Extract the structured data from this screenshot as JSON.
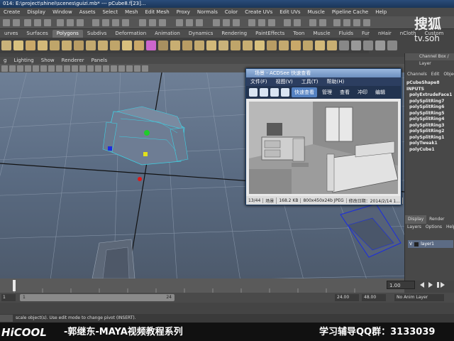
{
  "window": {
    "title": "014: E:\\project\\shinei\\scenes\\guizi.mb*  ---  pCube8.f[23]..."
  },
  "menubar": [
    "Create",
    "Display",
    "Window",
    "Assets",
    "Select",
    "Mesh",
    "Edit Mesh",
    "Proxy",
    "Normals",
    "Color",
    "Create UVs",
    "Edit UVs",
    "Muscle",
    "Pipeline Cache",
    "Help"
  ],
  "shelf_tabs": [
    "urves",
    "Surfaces",
    "Polygons",
    "Subdivs",
    "Deformation",
    "Animation",
    "Dynamics",
    "Rendering",
    "PaintEffects",
    "Toon",
    "Muscle",
    "Fluids",
    "Fur",
    "nHair",
    "nCloth",
    "Custom"
  ],
  "shelf_active": "Polygons",
  "panel_menu": [
    "g",
    "Lighting",
    "Show",
    "Renderer",
    "Panels"
  ],
  "acdsee": {
    "title": "场景 - ACDSee 快速查看",
    "menu": [
      "文件(F)",
      "视图(V)",
      "工具(T)",
      "帮助(H)"
    ],
    "tabs": [
      "快速查看",
      "管理",
      "查看",
      "冲印",
      "编辑"
    ],
    "active_tab": "快速查看",
    "status": [
      "13/44",
      "场景",
      "168.2 KB",
      "800x450x24b JPEG",
      "修改日期：2014/2/14 1..."
    ]
  },
  "right_panel": {
    "header": "Channel Box / Layer",
    "menu": [
      "Channels",
      "Edit",
      "Object"
    ],
    "items": [
      "pCubeShape8",
      "INPUTS",
      "polyExtrudeFace1",
      "polySplitRing7",
      "polySplitRing6",
      "polySplitRing5",
      "polySplitRing4",
      "polySplitRing3",
      "polySplitRing2",
      "polySplitRing1",
      "polyTweak1",
      "polyCube1"
    ],
    "display_tabs": [
      "Display",
      "Render"
    ],
    "layer_menu": [
      "Layers",
      "Options",
      "Help"
    ],
    "layer_visibility": "V",
    "layer_name": "layer1"
  },
  "timeline": {
    "end_value": "1.00",
    "range_start": "1",
    "range_left": "1",
    "range_mid": "24",
    "range_end": "24.00",
    "range_max": "48.00",
    "anim_layer": "No Anim Layer"
  },
  "command_line": {
    "help": "scale object(s). Use edit mode to change pivot (INSERT)."
  },
  "watermark": {
    "brand": "搜狐",
    "url": "tv.soh"
  },
  "banner": {
    "logo": "HiCOOL",
    "text": "-郭继东-MAYA视频教程系列",
    "qq": "学习辅导QQ群：3133039"
  }
}
